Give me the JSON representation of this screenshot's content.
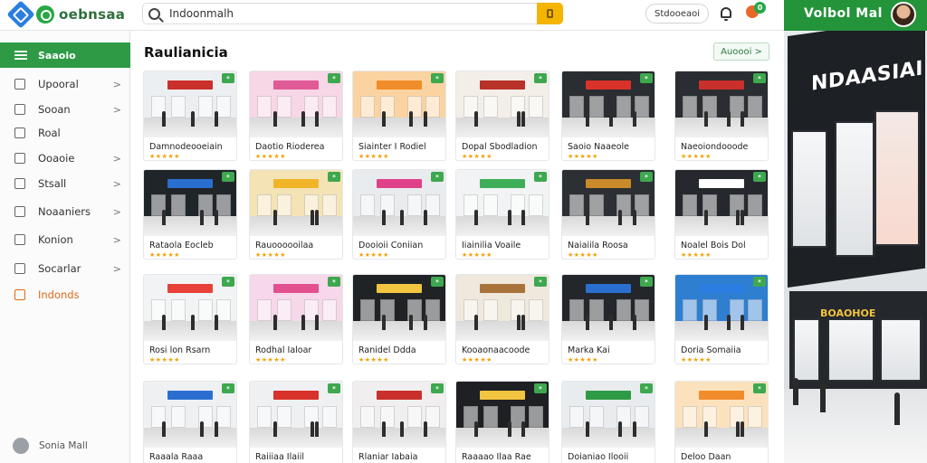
{
  "header": {
    "logo_text": "oebnsaa",
    "search_value": "Indoonmalh",
    "store_button": "Stdooeaoi",
    "cart_count": "0",
    "brand_title": "Volbol  Mal"
  },
  "sidebar": {
    "active": "Saaoio",
    "items": [
      {
        "label": "Upooral",
        "icon": "home-icon",
        "chevron": ">"
      },
      {
        "label": "Sooan",
        "icon": "grid-icon",
        "chevron": ">"
      },
      {
        "label": "Roal",
        "icon": "tag-icon",
        "chevron": ""
      },
      {
        "label": "Ooaoie",
        "icon": "list-icon",
        "chevron": ">"
      },
      {
        "label": "Stsall",
        "icon": "edit-icon",
        "chevron": ">"
      },
      {
        "label": "Noaaniers",
        "icon": "chat-icon",
        "chevron": ">"
      },
      {
        "label": "Konion",
        "icon": "box-icon",
        "chevron": ">"
      },
      {
        "label": "Socarlar",
        "icon": "star-icon",
        "chevron": ">"
      },
      {
        "label": "Indonds",
        "icon": "alert-icon",
        "chevron": ""
      }
    ],
    "footer_user": "Sonia Mall"
  },
  "main": {
    "title": "Raulianicia",
    "filter_button": "Auoooi  >",
    "cards": [
      {
        "name": "Damnodeooeiain",
        "accent": "#c9302c",
        "bg": "#eceff1",
        "badge": "*"
      },
      {
        "name": "Daotio Rioderea",
        "accent": "#e05a97",
        "bg": "#f7d6e6",
        "badge": "*"
      },
      {
        "name": "Siainter I Rodiel",
        "accent": "#f08c2a",
        "bg": "#fbd3a0",
        "badge": "*"
      },
      {
        "name": "Dopal Sbodladion",
        "accent": "#b8322a",
        "bg": "#f3efe8",
        "badge": "*"
      },
      {
        "name": "Saoio Naaeole",
        "accent": "#d8322a",
        "bg": "#2a2d31",
        "badge": "*"
      },
      {
        "name": "Naeoiondooode",
        "accent": "#c9302c",
        "bg": "#2a2d31",
        "badge": "*"
      },
      {
        "name": "Rataola Eocleb",
        "accent": "#2a6fd0",
        "bg": "#20252a",
        "badge": "*"
      },
      {
        "name": "Rauoooooilaa",
        "accent": "#f0b429",
        "bg": "#f4e3b5",
        "badge": "*"
      },
      {
        "name": "Dooioii Coniian",
        "accent": "#e0408a",
        "bg": "#e9ecef",
        "badge": "*"
      },
      {
        "name": "Iiainilia Voaile",
        "accent": "#3fae58",
        "bg": "#f1f3f4",
        "badge": "*"
      },
      {
        "name": "Naiaiila Roosa",
        "accent": "#c98a2a",
        "bg": "#2c2f33",
        "badge": "*"
      },
      {
        "name": "Noalel Bois Dol",
        "accent": "#ffffff",
        "bg": "#25292d",
        "badge": "*"
      },
      {
        "name": "Rosi lon Rsarn",
        "accent": "#e8413a",
        "bg": "#f2f3f4",
        "badge": "*"
      },
      {
        "name": "Rodhal Ialoar",
        "accent": "#e2508f",
        "bg": "#f6d8ea",
        "badge": "*"
      },
      {
        "name": "Ranidel Ddda",
        "accent": "#f3c440",
        "bg": "#202326",
        "badge": "*"
      },
      {
        "name": "Kooaonaacoode",
        "accent": "#a8733a",
        "bg": "#efe8dc",
        "badge": "*"
      },
      {
        "name": "Marka Kai",
        "accent": "#2a6fd0",
        "bg": "#23272b",
        "badge": "*"
      },
      {
        "name": "Doria Somaiia",
        "accent": "#2a7de1",
        "bg": "#2f7fd0",
        "badge": "*"
      },
      {
        "name": "Raaala Raaa",
        "accent": "#2a6fd0",
        "bg": "#eef0f2",
        "badge": "*"
      },
      {
        "name": "Raiiiaa Ilaiil",
        "accent": "#d8322a",
        "bg": "#eef0f2",
        "badge": "*"
      },
      {
        "name": "Rlaniar Iabaia",
        "accent": "#c9302c",
        "bg": "#f0eeee",
        "badge": "*"
      },
      {
        "name": "Raaaao Ilaa Rae",
        "accent": "#f3c440",
        "bg": "#1e2023",
        "badge": "*"
      },
      {
        "name": "Doianiao Ilooii",
        "accent": "#2f9a45",
        "bg": "#e9ecef",
        "badge": "*"
      },
      {
        "name": "Deloo Daan",
        "accent": "#f08c2a",
        "bg": "#fbe2bd",
        "badge": "*"
      }
    ],
    "stars": "★★★★★"
  },
  "promo": {
    "sign": "NDAASIAI",
    "sign2": "BOAOHOE"
  }
}
